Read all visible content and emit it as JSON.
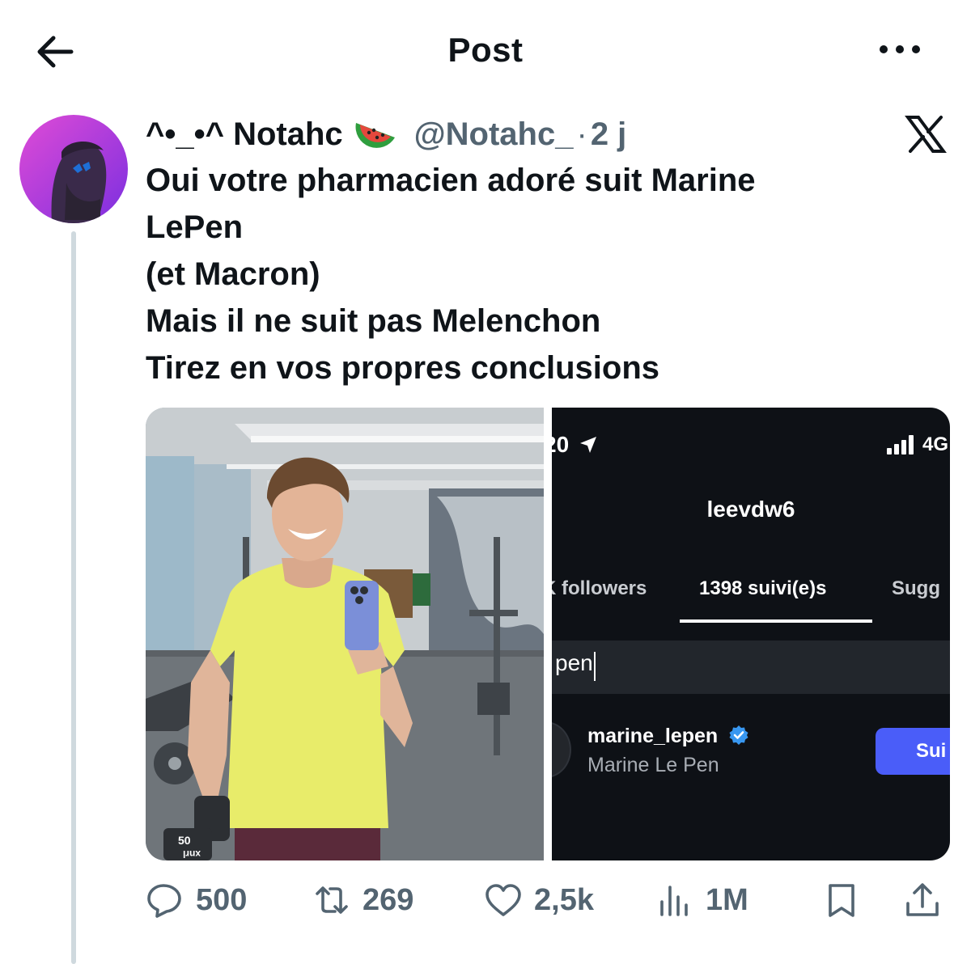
{
  "header": {
    "title": "Post"
  },
  "tweet": {
    "display_name": "^•_•^ Notahc",
    "handle": "@Notahc_",
    "separator": "·",
    "time": "2 j",
    "text_lines": [
      "Oui votre pharmacien adoré suit Marine",
      "LePen",
      "(et Macron)",
      "Mais il ne suit pas Melenchon",
      "Tirez en vos propres conclusions"
    ]
  },
  "media": {
    "screenshot": {
      "status_time": "20",
      "network": "4G",
      "username": "leevdw6",
      "tabs": {
        "followers": "K followers",
        "following": "1398 suivi(e)s",
        "suggested": "Sugg"
      },
      "search_query": "pen",
      "result": {
        "username": "marine_lepen",
        "name": "Marine Le Pen",
        "button": "Sui"
      },
      "dumbbell_weight": "50",
      "dumbbell_brand": "xnrl"
    }
  },
  "actions": {
    "replies": "500",
    "reposts": "269",
    "likes": "2,5k",
    "views": "1M"
  },
  "colors": {
    "text": "#0f1419",
    "muted": "#536471",
    "thread_line": "#cfd9de",
    "ig_background": "#0e1116",
    "ig_button": "#4a5df9",
    "verified": "#3897f0",
    "shirt": "#e8ec6a"
  },
  "icons": [
    "back-arrow-icon",
    "more-icon",
    "watermelon-icon",
    "x-logo-icon",
    "reply-icon",
    "repost-icon",
    "like-icon",
    "views-icon",
    "bookmark-icon",
    "share-icon",
    "location-arrow-icon",
    "signal-icon",
    "verified-icon"
  ]
}
